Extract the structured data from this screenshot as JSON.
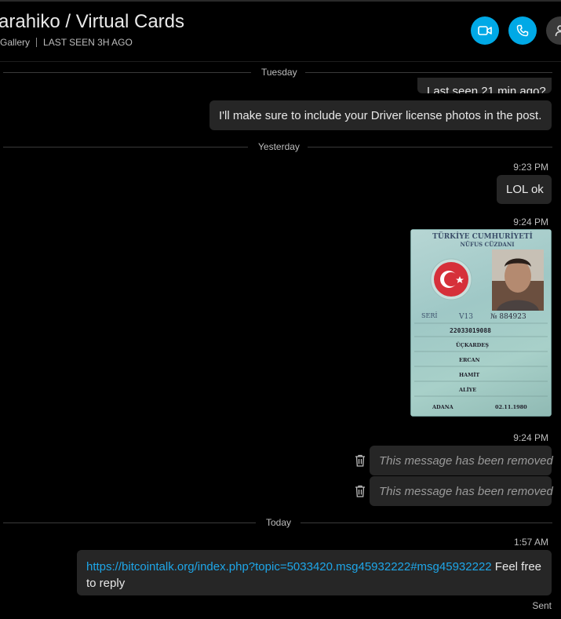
{
  "header": {
    "title": "arahiko / Virtual Cards",
    "gallery": "Gallery",
    "last_seen": "LAST SEEN 3H AGO"
  },
  "dividers": {
    "tuesday": "Tuesday",
    "yesterday": "Yesterday",
    "today": "Today"
  },
  "messages": {
    "partial": "Last seen 21 min ago?",
    "driver": "I'll make sure to include your Driver license photos in the post.",
    "time_1": "9:23 PM",
    "lol": "LOL ok",
    "time_2": "9:24 PM",
    "time_3": "9:24 PM",
    "removed_1": "This message has been removed",
    "removed_2": "This message has been removed",
    "time_4": "1:57 AM",
    "link_url": "https://bitcointalk.org/index.php?topic=5033420.msg45932222#msg45932222",
    "link_suffix": " Feel free",
    "link_line2": "to reply",
    "status": "Sent"
  },
  "idcard": {
    "title1": "TÜRKİYE CUMHURİYETİ",
    "title2": "NÜFUS CÜZDANI",
    "serial": "SERİ",
    "serial_code": "V13",
    "number": "№ 884923",
    "tc": "22033019088",
    "surname": "ÜÇKARDEŞ",
    "name": "ERCAN",
    "father": "HAMİT",
    "mother": "ALİYE",
    "birthplace": "ADANA",
    "birthdate": "02.11.1980"
  },
  "icons": {
    "video": "video-camera-icon",
    "call": "phone-icon",
    "profile": "person-icon",
    "trash": "trash-icon"
  },
  "colors": {
    "accent": "#00a9e6",
    "bubble": "#262626",
    "background": "#000000"
  }
}
